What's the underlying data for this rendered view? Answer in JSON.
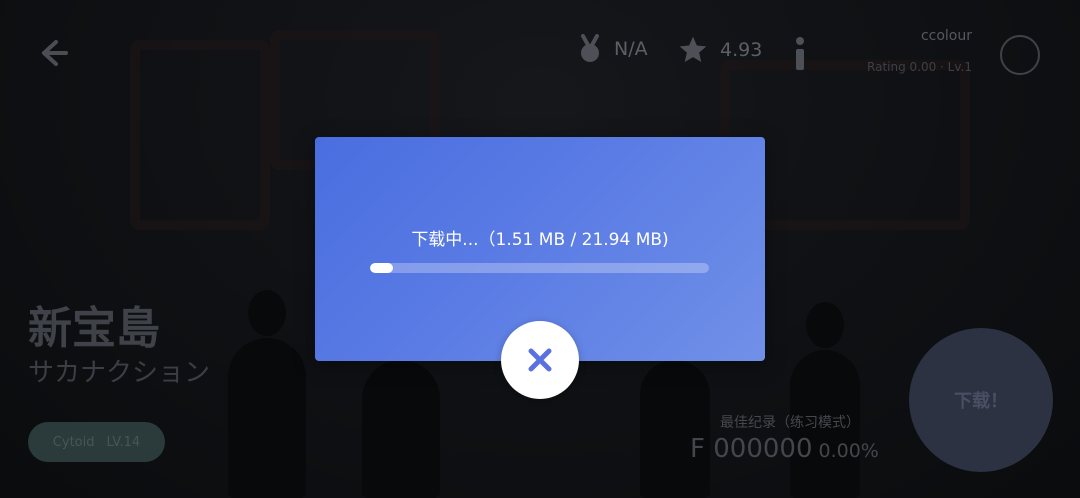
{
  "header": {
    "rank_value": "N/A",
    "rating_value": "4.93",
    "user_name": "ccolour",
    "user_sub": "Rating 0.00 · Lv.1"
  },
  "song": {
    "title": "新宝島",
    "artist": "サカナクション",
    "chart_type": "Cytoid",
    "level": "LV.14"
  },
  "best_record": {
    "label": "最佳纪录（练习模式）",
    "grade": "F",
    "score": "000000",
    "accuracy": "0.00%"
  },
  "download_button": {
    "label": "下载！"
  },
  "download_dialog": {
    "status_text": "下载中...（1.51 MB / 21.94 MB)",
    "progress_fraction": 0.069,
    "close_icon": "close-icon"
  },
  "colors": {
    "dialog_start": "#4a6ee0",
    "dialog_end": "#7090e8",
    "close_icon": "#5a72e0"
  }
}
